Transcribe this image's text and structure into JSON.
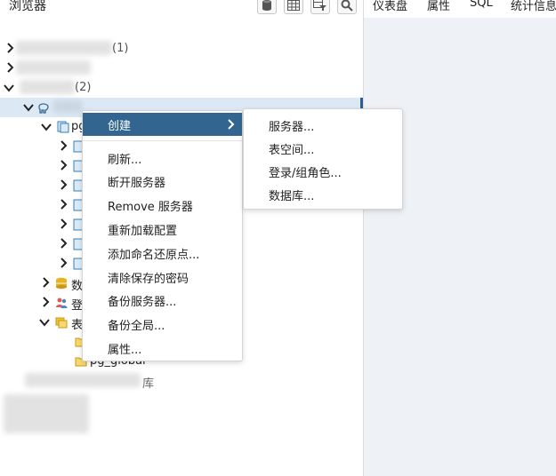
{
  "browser": {
    "title": "浏览器",
    "toolbar": [
      {
        "name": "query-tool-button",
        "icon": "database-icon"
      },
      {
        "name": "view-data-button",
        "icon": "table-grid-icon"
      },
      {
        "name": "filter-rows-button",
        "icon": "filtered-table-icon"
      },
      {
        "name": "search-objects-button",
        "icon": "search-icon"
      }
    ]
  },
  "tabs": [
    "仪表盘",
    "属性",
    "SQL",
    "统计信息"
  ],
  "tree": {
    "nodes": [
      {
        "label": "pg"
      },
      {
        "label": "数"
      },
      {
        "label": "登"
      },
      {
        "label": "表"
      },
      {
        "label": "pg_global"
      }
    ],
    "obscured_text": [
      "(1)",
      "(2)",
      "库"
    ]
  },
  "context_menu": {
    "items": [
      "创建",
      "刷新...",
      "断开服务器",
      "Remove 服务器",
      "重新加载配置",
      "添加命名还原点...",
      "清除保存的密码",
      "备份服务器...",
      "备份全局...",
      "属性..."
    ],
    "active": "创建"
  },
  "submenu": {
    "items": [
      "服务器...",
      "表空间...",
      "登录/组角色...",
      "数据库..."
    ]
  },
  "colors": {
    "menu_active": "#326690",
    "selected_row": "#dce9f5",
    "right_panel_bg": "#eef1f5",
    "db_icon": "#3a7fb8",
    "folder_icon": "#f1c232"
  }
}
